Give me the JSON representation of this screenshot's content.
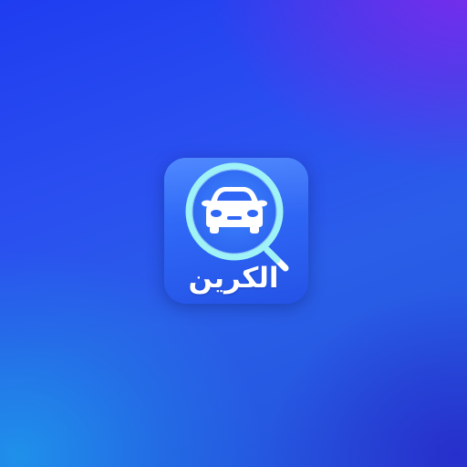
{
  "app": {
    "label": "الكرين",
    "icon": "car-search-icon",
    "colors": {
      "background_top_right": "#7a2ae6",
      "background_main": "#2a4ff0",
      "background_bottom_left": "#1e96eb",
      "icon_tile": "#2f66f5",
      "lens_ring": "#9ff3f7",
      "car": "#ffffff"
    }
  }
}
